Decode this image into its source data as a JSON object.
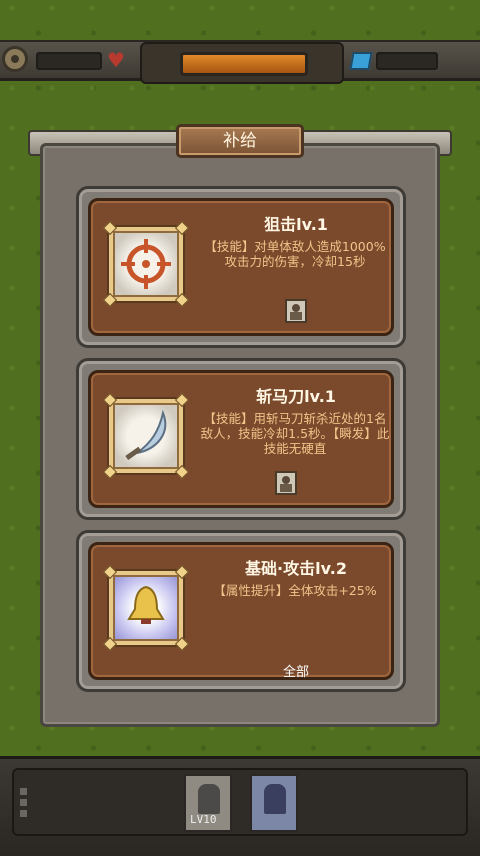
{
  "panel": {
    "title": "补给"
  },
  "cards": [
    {
      "name": "狙击lv.1",
      "desc": "【技能】对单体敌人造成1000%攻击力的伤害，冷却15秒",
      "icon": "crosshair-icon",
      "extra": ""
    },
    {
      "name": "斩马刀lv.1",
      "desc": "【技能】用斩马刀斩杀近处的1名敌人，技能冷却1.5秒。【瞬发】此技能无硬直",
      "icon": "scimitar-icon",
      "extra": ""
    },
    {
      "name": "基础·攻击lv.2",
      "desc": "【属性提升】全体攻击+25%",
      "icon": "bell-icon",
      "extra": "全部"
    }
  ],
  "bottom_units": [
    {
      "label": "LV10"
    },
    {
      "label": ""
    }
  ],
  "colors": {
    "card_bg": "#7b4a2c",
    "desc_text": "#f0c48a",
    "hp": "#e08a2a"
  }
}
